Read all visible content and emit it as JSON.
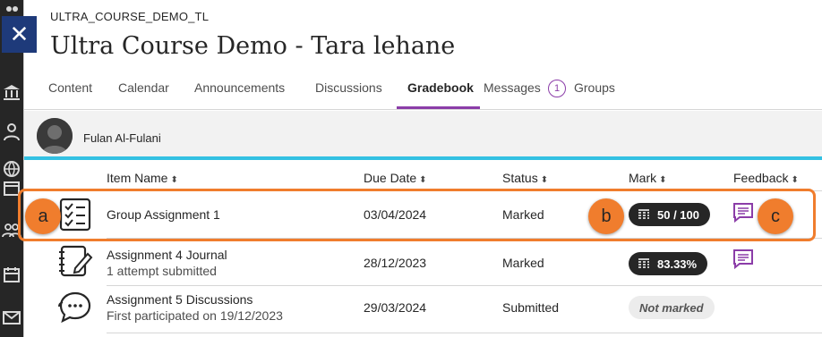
{
  "window": {
    "close_label": "✕"
  },
  "course": {
    "code": "ULTRA_COURSE_DEMO_TL",
    "title": "Ultra Course Demo - Tara lehane"
  },
  "tabs": [
    {
      "label": "Content"
    },
    {
      "label": "Calendar"
    },
    {
      "label": "Announcements"
    },
    {
      "label": "Discussions"
    },
    {
      "label": "Gradebook",
      "active": true
    },
    {
      "label": "Messages",
      "badge": "1"
    },
    {
      "label": "Groups"
    }
  ],
  "student": {
    "name": "Fulan Al-Fulani"
  },
  "table": {
    "headers": {
      "item_name": "Item Name",
      "due_date": "Due Date",
      "status": "Status",
      "mark": "Mark",
      "feedback": "Feedback"
    },
    "sort_glyph": "⬍",
    "rows": [
      {
        "icon": "assignment-checklist-icon",
        "name": "Group Assignment 1",
        "sub": "",
        "due": "03/04/2024",
        "status": "Marked",
        "mark": "50 / 100",
        "feedback": true
      },
      {
        "icon": "journal-icon",
        "name": "Assignment 4 Journal",
        "sub": "1 attempt submitted",
        "due": "28/12/2023",
        "status": "Marked",
        "mark": "83.33%",
        "feedback": true
      },
      {
        "icon": "discussion-icon",
        "name": "Assignment 5 Discussions",
        "sub": "First participated on 19/12/2023",
        "due": "29/03/2024",
        "status": "Submitted",
        "mark": "Not marked",
        "feedback": false
      }
    ]
  },
  "callouts": {
    "a": "a",
    "b": "b",
    "c": "c"
  },
  "colors": {
    "accent": "#8b3da8",
    "highlight": "#f07d2d",
    "cyan": "#33c1e3",
    "close_bg": "#1e3a7a"
  }
}
